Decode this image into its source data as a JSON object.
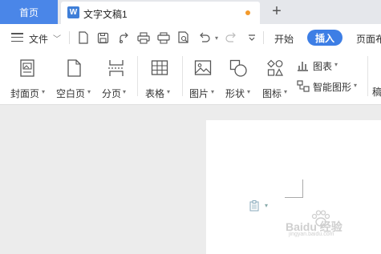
{
  "titlebar": {
    "home_tab": "首页",
    "doc_tab": {
      "icon_letter": "W",
      "title": "文字文稿1"
    },
    "new_tab_symbol": "+"
  },
  "quickbar": {
    "file_label": "文件",
    "tabs": {
      "start": "开始",
      "insert": "插入",
      "layout": "页面布"
    }
  },
  "ribbon": {
    "items": {
      "cover_page": "封面页",
      "blank_page": "空白页",
      "page_break": "分页",
      "table": "表格",
      "picture": "图片",
      "shapes": "形状",
      "icons": "图标",
      "chart": "图表",
      "smart_art": "智能图形",
      "more": "稿"
    }
  },
  "watermark": {
    "text": "Baidu 经验",
    "subtext": "jingyan.baidu.com"
  },
  "colors": {
    "accent": "#3d7ee5",
    "home_tab": "#4a86e8",
    "unsaved_dot": "#f39a2b"
  }
}
